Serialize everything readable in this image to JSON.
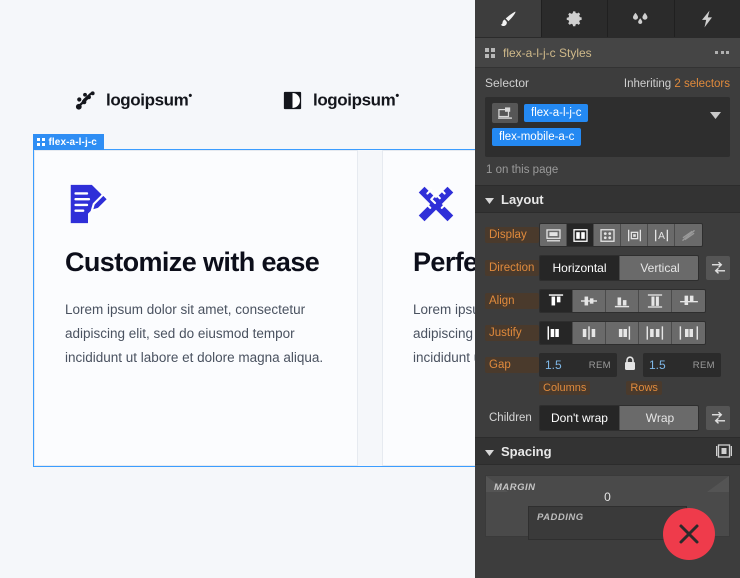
{
  "canvas": {
    "logos": [
      {
        "name": "logoipsum-dots",
        "text": "logoipsum",
        "mark": "dots-diagonal"
      },
      {
        "name": "logoipsum-circle",
        "text": "logoipsum",
        "mark": "split-circle"
      }
    ],
    "selection_badge": {
      "label": "flex-a-l-j-c",
      "icon": "grid-handle-icon"
    },
    "cards": [
      {
        "icon": "document-edit-icon",
        "title": "Customize with ease",
        "body": "Lorem ipsum dolor sit amet, consectetur adipiscing elit, sed do eiusmod tempor incididunt ut labore et dolore magna aliqua."
      },
      {
        "icon": "ruler-pencil-icon",
        "title": "Perfectly Responsive",
        "body": "Lorem ipsum dolor sit amet, consectetur adipiscing elit, sed do eiusmod tempor incididunt ut labore et dolore magna aliqua."
      }
    ],
    "accent": "#2f2fd8",
    "selection_color": "#2f8ef4"
  },
  "panel": {
    "tabs": [
      {
        "name": "style-tab",
        "icon": "paintbrush-icon",
        "active": true
      },
      {
        "name": "settings-tab",
        "icon": "gear-icon",
        "active": false
      },
      {
        "name": "effects-tab",
        "icon": "droplets-icon",
        "active": false
      },
      {
        "name": "interactions-tab",
        "icon": "lightning-icon",
        "active": false
      }
    ],
    "header": {
      "title": "flex-a-l-j-c Styles",
      "grid_icon": "grid-icon",
      "more_icon": "more-options-icon"
    },
    "selector": {
      "label": "Selector",
      "inheriting_prefix": "Inheriting",
      "inheriting_count": "2 selectors",
      "state_icon": "selector-state-icon",
      "chips": [
        "flex-a-l-j-c",
        "flex-mobile-a-c"
      ],
      "caret_icon": "chevron-down-icon",
      "count_text": "1 on this page"
    },
    "layout": {
      "title": "Layout",
      "display": {
        "label": "Display",
        "options": [
          {
            "name": "display-block",
            "icon": "block-icon",
            "selected": false
          },
          {
            "name": "display-flex",
            "icon": "flex-icon",
            "selected": true
          },
          {
            "name": "display-grid",
            "icon": "grid-icon",
            "selected": false
          },
          {
            "name": "display-inline-block",
            "icon": "inline-block-icon",
            "selected": false
          },
          {
            "name": "display-inline",
            "icon": "inline-text-icon",
            "selected": false
          },
          {
            "name": "display-none",
            "icon": "none-icon",
            "selected": false
          }
        ]
      },
      "direction": {
        "label": "Direction",
        "options": [
          {
            "label": "Horizontal",
            "selected": true
          },
          {
            "label": "Vertical",
            "selected": false
          }
        ],
        "reverse_icon": "reverse-direction-icon"
      },
      "align": {
        "label": "Align",
        "options": [
          {
            "name": "align-start",
            "selected": true
          },
          {
            "name": "align-center",
            "selected": false
          },
          {
            "name": "align-end",
            "selected": false
          },
          {
            "name": "align-stretch",
            "selected": false
          },
          {
            "name": "align-baseline",
            "selected": false
          }
        ]
      },
      "justify": {
        "label": "Justify",
        "options": [
          {
            "name": "justify-start",
            "selected": true
          },
          {
            "name": "justify-center",
            "selected": false
          },
          {
            "name": "justify-end",
            "selected": false
          },
          {
            "name": "justify-space-between",
            "selected": false
          },
          {
            "name": "justify-space-around",
            "selected": false
          }
        ]
      },
      "gap": {
        "label": "Gap",
        "columns": {
          "value": "1.5",
          "unit": "REM",
          "caption": "Columns"
        },
        "rows": {
          "value": "1.5",
          "unit": "REM",
          "caption": "Rows"
        },
        "lock_icon": "lock-closed-icon"
      },
      "children": {
        "label": "Children",
        "options": [
          {
            "label": "Don't wrap",
            "selected": true
          },
          {
            "label": "Wrap",
            "selected": false
          }
        ],
        "reverse_icon": "reverse-wrap-icon"
      }
    },
    "spacing": {
      "title": "Spacing",
      "corner_icon": "spacing-mode-icon",
      "margin_label": "MARGIN",
      "margin_value": "0",
      "padding_label": "PADDING"
    },
    "colors": {
      "panel_bg": "#3d3d3d",
      "chip_blue": "#2489f2",
      "label_orange": "#e08a3c",
      "value_blue": "#7fb8e8"
    }
  },
  "overlay": {
    "close_button": {
      "name": "close-overlay-button",
      "icon": "x-icon",
      "color": "#ef3b4b"
    }
  }
}
